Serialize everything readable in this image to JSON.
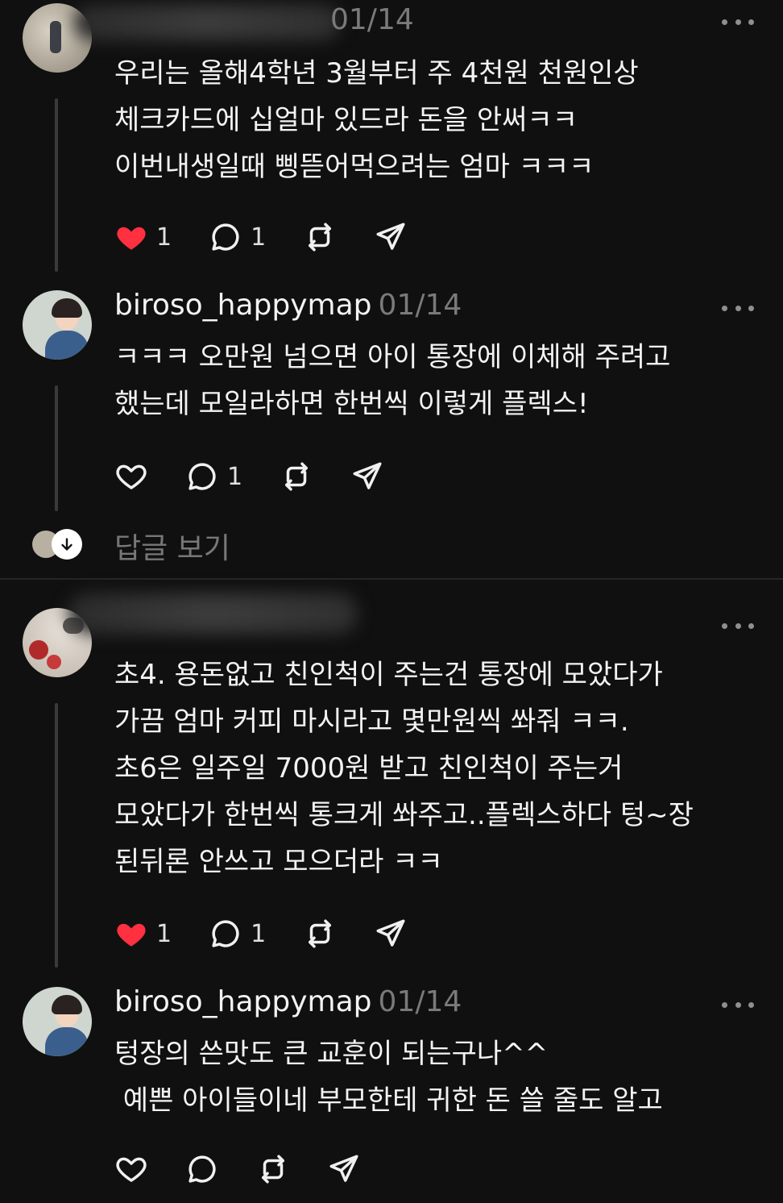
{
  "comments": [
    {
      "username": "",
      "date": "01/14",
      "lines": [
        "우리는 올해4학년 3월부터 주 4천원  천원인상",
        "체크카드에 십얼마 있드라 돈을 안써ㅋㅋ",
        "이번내생일때 삥뜯어먹으려는  엄마 ㅋㅋㅋ"
      ],
      "likes": "1",
      "liked": true,
      "replies": "1"
    },
    {
      "username": "biroso_happymap",
      "date": "01/14",
      "lines": [
        "ㅋㅋㅋ 오만원 넘으면 아이 통장에 이체해 주려고",
        "했는데 모일라하면 한번씩 이렇게 플렉스!"
      ],
      "likes": "",
      "liked": false,
      "replies": "1"
    },
    {
      "username": "",
      "date": "",
      "lines": [
        "초4. 용돈없고 친인척이 주는건 통장에 모았다가",
        "가끔 엄마 커피 마시라고 몇만원씩 쏴줘 ㅋㅋ.",
        "초6은 일주일 7000원 받고 친인척이 주는거",
        "모았다가 한번씩 통크게 쏴주고..플렉스하다 텅~장",
        "된뒤론 안쓰고 모으더라 ㅋㅋ"
      ],
      "likes": "1",
      "liked": true,
      "replies": "1"
    },
    {
      "username": "biroso_happymap",
      "date": "01/14",
      "lines": [
        "텅장의 쓴맛도 큰 교훈이 되는구나^^",
        " 예쁜 아이들이네 부모한테 귀한 돈 쓸 줄도 알고"
      ],
      "likes": "",
      "liked": false,
      "replies": ""
    }
  ],
  "view_replies_label": "답글 보기",
  "colors": {
    "background": "#101010",
    "heart_liked": "#ff3040",
    "secondary_text": "#7a7a7a",
    "thread_line": "#3a3a3a"
  },
  "icons": [
    "heart-icon",
    "reply-icon",
    "repost-icon",
    "share-icon",
    "more-icon",
    "arrow-down-icon"
  ]
}
